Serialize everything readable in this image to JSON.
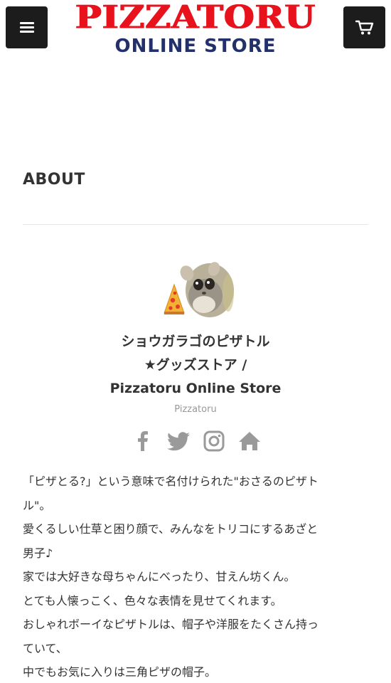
{
  "header": {
    "menu_icon": "hamburger-menu-icon",
    "cart_icon": "shopping-cart-icon",
    "logo_main": "PIZZATORU",
    "logo_sub": "ONLINE STORE",
    "colors": {
      "logo_red": "#e8121d",
      "logo_navy": "#22306b",
      "button_bg": "#1c1c1c"
    }
  },
  "about": {
    "title": "ABOUT",
    "store_name": [
      "ショウガラゴのピザトル",
      "★グッズストア /",
      "Pizzatoru Online Store"
    ],
    "owner": "Pizzatoru",
    "social": [
      {
        "name": "facebook",
        "icon": "facebook-icon"
      },
      {
        "name": "twitter",
        "icon": "twitter-icon"
      },
      {
        "name": "instagram",
        "icon": "instagram-icon"
      },
      {
        "name": "home",
        "icon": "home-icon"
      }
    ],
    "text_lines": [
      "「ピザとる?」という意味で名付けられた\"おさるのピザト",
      "ル\"。",
      "愛くるしい仕草と困り顔で、みんなをトリコにするあざと",
      "男子♪",
      "家では大好きな母ちゃんにべったり、甘えん坊くん。",
      "とても人懐っこく、色々な表情を見せてくれます。",
      "おしゃれボーイなピザトルは、帽子や洋服をたくさん持っ",
      "ていて、",
      "中でもお気に入りは三角ピザの帽子。"
    ]
  }
}
